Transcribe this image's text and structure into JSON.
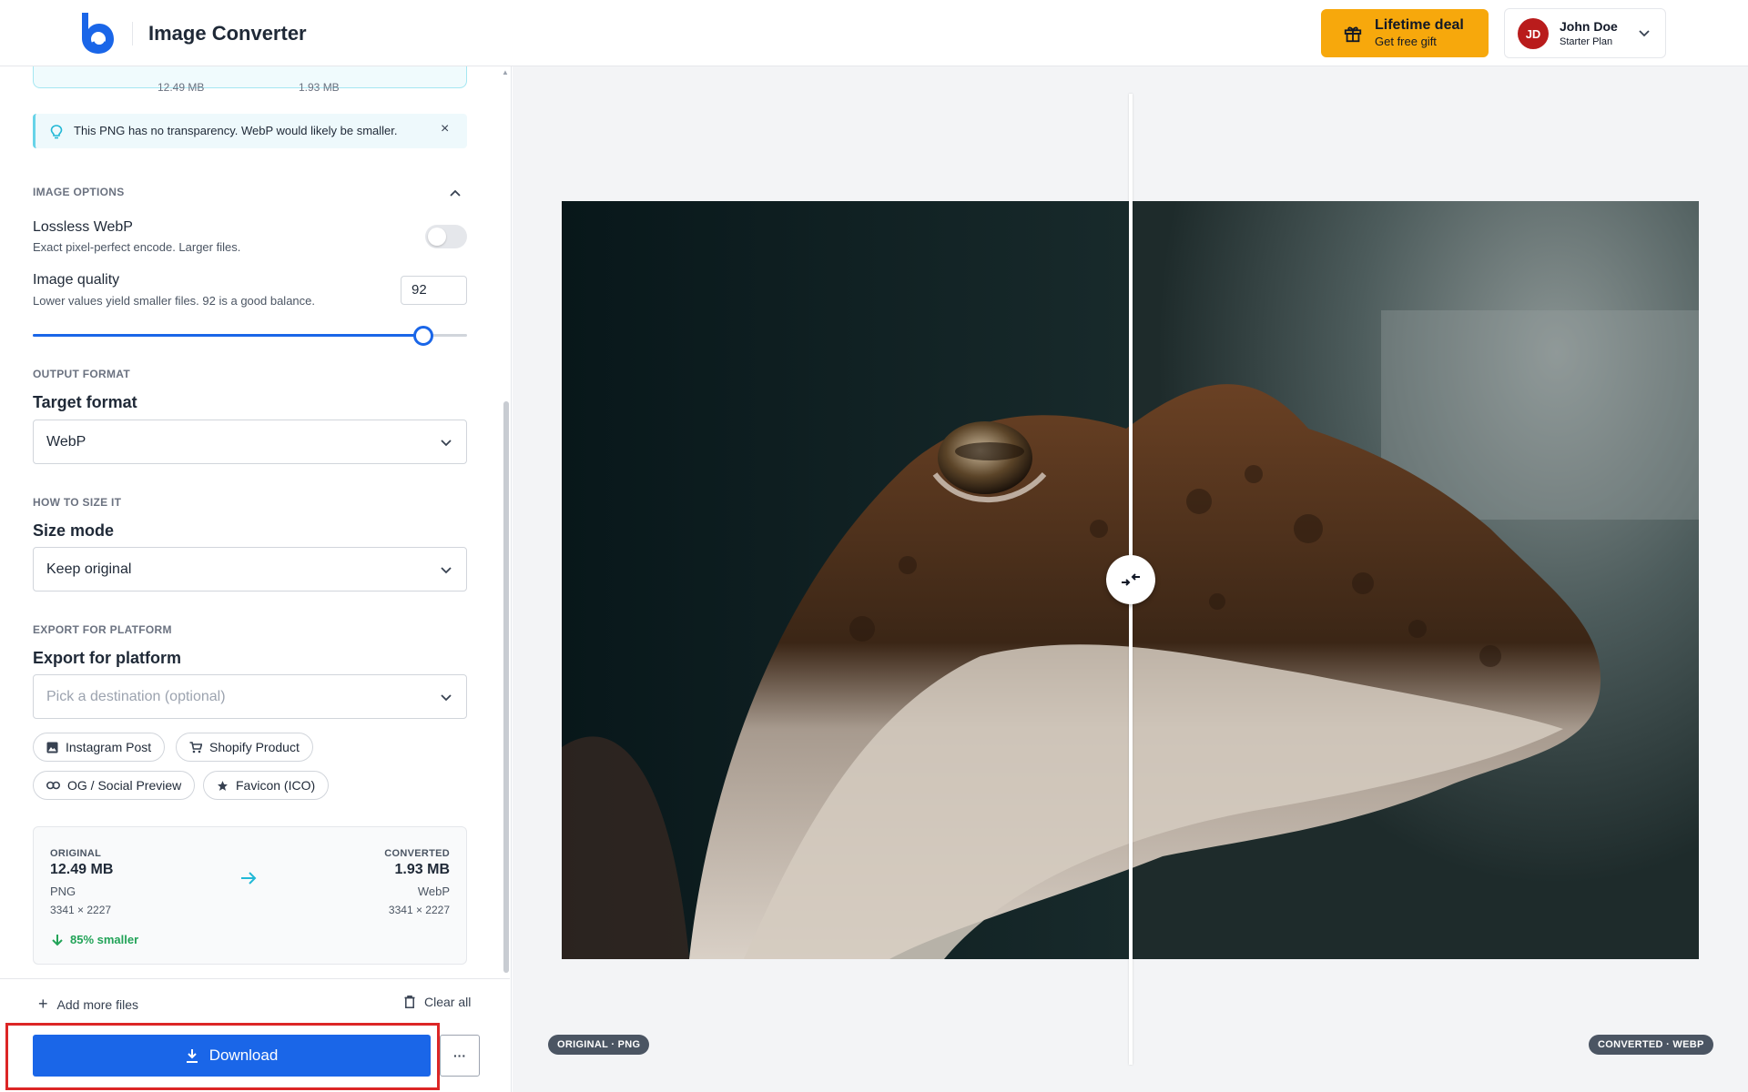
{
  "header": {
    "app_title": "Image Converter",
    "deal": {
      "title": "Lifetime deal",
      "subtitle": "Get free gift",
      "color": "#f7a80c"
    },
    "user": {
      "initials": "JD",
      "name": "John Doe",
      "plan": "Starter Plan"
    }
  },
  "sidebar": {
    "top_card": {
      "original_size": "12.49 MB",
      "converted_size": "1.93 MB"
    },
    "tip": {
      "text": "This PNG has no transparency. WebP would likely be smaller.",
      "close": "×"
    },
    "image_options": {
      "section_label": "IMAGE OPTIONS",
      "lossless": {
        "title": "Lossless WebP",
        "description": "Exact pixel-perfect encode. Larger files.",
        "enabled": false
      },
      "quality": {
        "title": "Image quality",
        "description": "Lower values yield smaller files. 92 is a good balance.",
        "value": "92",
        "slider_fraction": 0.9
      }
    },
    "output_format": {
      "section_label": "OUTPUT FORMAT",
      "title": "Target format",
      "selected": "WebP"
    },
    "sizing": {
      "section_label": "HOW TO SIZE IT",
      "title": "Size mode",
      "selected": "Keep original"
    },
    "platform": {
      "section_label": "EXPORT FOR PLATFORM",
      "title": "Export for platform",
      "placeholder": "Pick a destination (optional)",
      "chips": [
        {
          "label": "Instagram Post",
          "icon": "image-icon"
        },
        {
          "label": "Shopify Product",
          "icon": "cart-icon"
        },
        {
          "label": "OG / Social Preview",
          "icon": "link-icon"
        },
        {
          "label": "Favicon (ICO)",
          "icon": "star-icon"
        }
      ]
    },
    "comparison": {
      "original_label": "ORIGINAL",
      "original_size": "12.49 MB",
      "original_format": "PNG",
      "original_dims": "3341 × 2227",
      "converted_label": "CONVERTED",
      "converted_size": "1.93 MB",
      "converted_format": "WebP",
      "converted_dims": "3341 × 2227",
      "savings": "85% smaller"
    },
    "footer": {
      "add_more": "Add more files",
      "clear_all": "Clear all",
      "download": "Download",
      "more": "···"
    }
  },
  "preview": {
    "left_badge": "ORIGINAL · PNG",
    "right_badge": "CONVERTED · WEBP",
    "split_fraction": 0.5
  },
  "colors": {
    "accent": "#1a66e8",
    "success": "#22a358",
    "highlight": "#dc2626"
  }
}
